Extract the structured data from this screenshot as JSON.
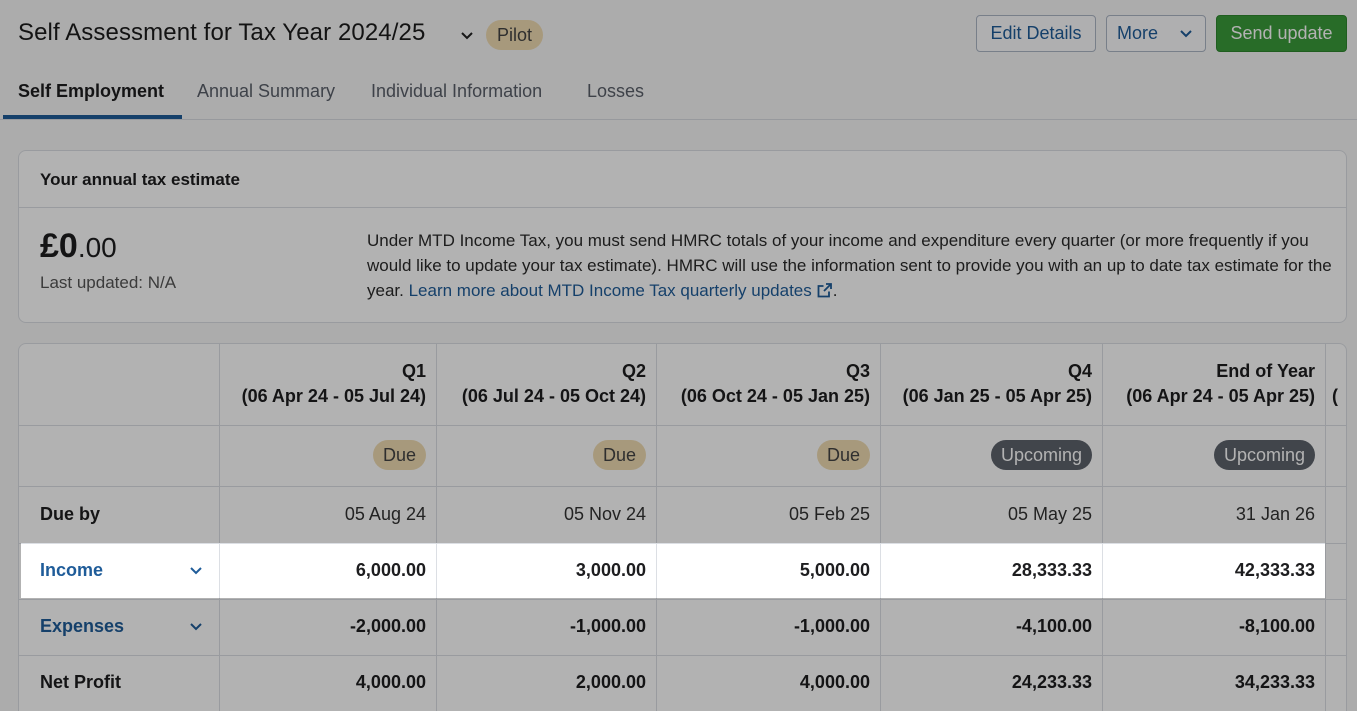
{
  "header": {
    "title": "Self Assessment for Tax Year 2024/25",
    "badge": "Pilot",
    "buttons": {
      "edit": "Edit Details",
      "more": "More",
      "send": "Send update"
    }
  },
  "tabs": [
    "Self Employment",
    "Annual Summary",
    "Individual Information",
    "Losses"
  ],
  "estimate": {
    "title": "Your annual tax estimate",
    "amount_main": "£0",
    "amount_pence": ".00",
    "last_updated": "Last updated: N/A",
    "info_text": "Under MTD Income Tax, you must send HMRC totals of your income and expenditure every quarter (or more frequently if you would like to update your tax estimate). HMRC will use the information sent to provide you with an up to date tax estimate for the year. ",
    "info_link": "Learn more about MTD Income Tax quarterly updates",
    "info_end": "."
  },
  "table": {
    "columns": [
      {
        "name": "Q1",
        "range": "(06 Apr 24 - 05 Jul 24)",
        "status": "Due",
        "due_by": "05 Aug 24",
        "income": "6,000.00",
        "expenses": "-2,000.00",
        "net_profit": "4,000.00"
      },
      {
        "name": "Q2",
        "range": "(06 Jul 24 - 05 Oct 24)",
        "status": "Due",
        "due_by": "05 Nov 24",
        "income": "3,000.00",
        "expenses": "-1,000.00",
        "net_profit": "2,000.00"
      },
      {
        "name": "Q3",
        "range": "(06 Oct 24 - 05 Jan 25)",
        "status": "Due",
        "due_by": "05 Feb 25",
        "income": "5,000.00",
        "expenses": "-1,000.00",
        "net_profit": "4,000.00"
      },
      {
        "name": "Q4",
        "range": "(06 Jan 25 - 05 Apr 25)",
        "status": "Upcoming",
        "due_by": "05 May 25",
        "income": "28,333.33",
        "expenses": "-4,100.00",
        "net_profit": "24,233.33"
      },
      {
        "name": "End of Year",
        "range": "(06 Apr 24 - 05 Apr 25)",
        "status": "Upcoming",
        "due_by": "31 Jan 26",
        "income": "42,333.33",
        "expenses": "-8,100.00",
        "net_profit": "34,233.33"
      }
    ],
    "partial_column_text": "(",
    "row_labels": {
      "due_by": "Due by",
      "income": "Income",
      "expenses": "Expenses",
      "net_profit": "Net Profit"
    }
  },
  "colors": {
    "accent": "#1f5c99",
    "send": "#3a9b3a",
    "due": "#f0dcb2",
    "upcoming": "#5d636c"
  }
}
